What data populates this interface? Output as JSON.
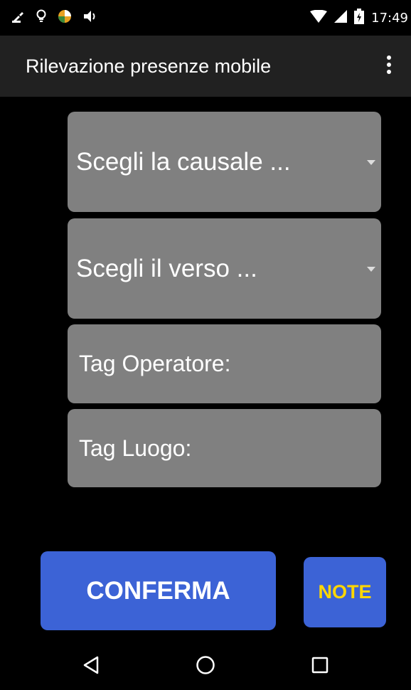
{
  "status_bar": {
    "time": "17:49",
    "left_icons": [
      "cleaner-icon",
      "lightbulb-icon",
      "app-icon",
      "volume-icon"
    ],
    "right_icons": [
      "wifi-icon",
      "signal-icon",
      "battery-icon"
    ]
  },
  "app_bar": {
    "title": "Rilevazione presenze mobile",
    "overflow_icon": "more-vert-icon"
  },
  "form": {
    "causale_placeholder": "Scegli la causale ...",
    "verso_placeholder": "Scegli il verso ...",
    "tag_operatore_label": "Tag Operatore:",
    "tag_luogo_label": "Tag Luogo:"
  },
  "buttons": {
    "confirm_label": "CONFERMA",
    "note_label": "NOTE"
  },
  "nav_bar": {
    "items": [
      "back-icon",
      "home-icon",
      "recents-icon"
    ]
  },
  "colors": {
    "field_background": "#808080",
    "button_background": "#3c63d6",
    "note_text": "#ffd700",
    "app_bar": "#212121"
  }
}
